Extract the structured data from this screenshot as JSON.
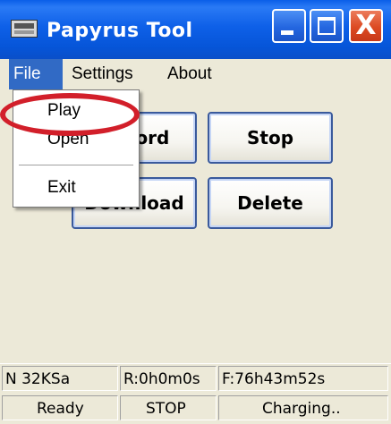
{
  "window": {
    "title": "Papyrus Tool",
    "icons": {
      "app": "tape-recorder-icon",
      "minimize": "minimize-icon",
      "maximize": "maximize-icon",
      "close": "close-icon"
    },
    "close_glyph": "X"
  },
  "menubar": {
    "items": [
      {
        "label": "File",
        "active": true
      },
      {
        "label": "Settings",
        "active": false
      },
      {
        "label": "About",
        "active": false
      }
    ]
  },
  "file_menu": {
    "items": [
      {
        "label": "Play",
        "highlighted": true
      },
      {
        "label": "Open",
        "highlighted": false
      },
      {
        "label": "Exit",
        "highlighted": false
      }
    ]
  },
  "buttons": {
    "record": "Record",
    "stop": "Stop",
    "download": "Download",
    "delete": "Delete"
  },
  "status_top": {
    "rate": "N 32KSa",
    "recorded": "R:0h0m0s",
    "free": "F:76h43m52s"
  },
  "status_bottom": {
    "state": "Ready",
    "mode": "STOP",
    "power": "Charging.."
  },
  "colors": {
    "titlebar": "#0a5ee8",
    "menu_selected": "#316ac5",
    "highlight_circle": "#d21f2a",
    "face": "#ece9d8"
  }
}
